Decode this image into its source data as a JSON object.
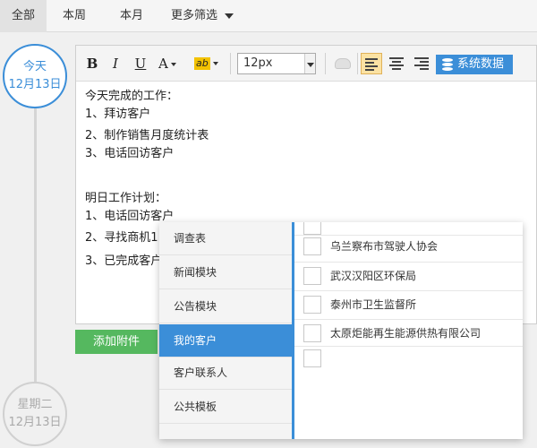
{
  "tabs": {
    "all": "全部",
    "week": "本周",
    "month": "本月",
    "more": "更多筛选"
  },
  "timeline": {
    "today": {
      "day": "今天",
      "date": "12月13日"
    },
    "tuesday": {
      "day": "星期二",
      "date": "12月13日"
    }
  },
  "toolbar": {
    "bold": "B",
    "italic": "I",
    "underline": "U",
    "font_color": "A",
    "highlight": "ab",
    "font_size": "12px",
    "system_data": "系统数据"
  },
  "editor": {
    "lines": [
      "今天完成的工作：",
      "1、拜访客户",
      "2、制作销售月度统计表",
      "3、电话回访客户",
      "",
      "明日工作计划：",
      "1、电话回访客户",
      "2、寻找商机1",
      "3、已完成客户"
    ]
  },
  "attach_button": "添加附件",
  "popup": {
    "categories": [
      "调查表",
      "新闻模块",
      "公告模块",
      "我的客户",
      "客户联系人",
      "公共模板"
    ],
    "active_category": "我的客户",
    "items": [
      "乌兰察布市驾驶人协会",
      "武汉汉阳区环保局",
      "泰州市卫生监督所",
      "太原炬能再生能源供热有限公司",
      ""
    ]
  },
  "colors": {
    "accent": "#3b8ed8",
    "green_button": "#55b85f",
    "highlight_active": "#fbe2a3"
  }
}
